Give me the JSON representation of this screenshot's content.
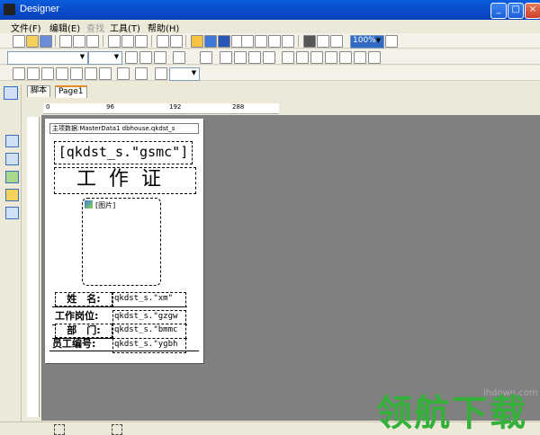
{
  "window": {
    "title": "Designer",
    "controls": [
      "minimize",
      "maximize",
      "close"
    ]
  },
  "menu": [
    {
      "label": "文件(F)",
      "enabled": true
    },
    {
      "label": "编辑(E)",
      "enabled": true
    },
    {
      "label": "查找",
      "enabled": false
    },
    {
      "label": "工具(T)",
      "enabled": true
    },
    {
      "label": "帮助(H)",
      "enabled": true
    }
  ],
  "toolbar": {
    "zoom": "100%"
  },
  "tabs": [
    "脚本",
    "Page1"
  ],
  "ruler": {
    "h_ticks": [
      "0",
      "96",
      "192",
      "288"
    ]
  },
  "report": {
    "band_header": "主项数据:MasterData1 dbhouse.qkdst_s",
    "company_field": "[qkdst_s.\"gsmc\"]",
    "title": "工作证",
    "photo_label": "[图片]",
    "rows": [
      {
        "label": "姓　名:",
        "value": "qkdst_s.\"xm\""
      },
      {
        "label": "工作岗位:",
        "value": "qkdst_s.\"gzgw"
      },
      {
        "label": "部　门:",
        "value": "qkdst_s.\"bmmc"
      },
      {
        "label": "员工编号:",
        "value": "qkdst_s.\"ygbh"
      }
    ]
  },
  "watermark": {
    "site": "lhdown.com",
    "logo": "领航下载"
  }
}
